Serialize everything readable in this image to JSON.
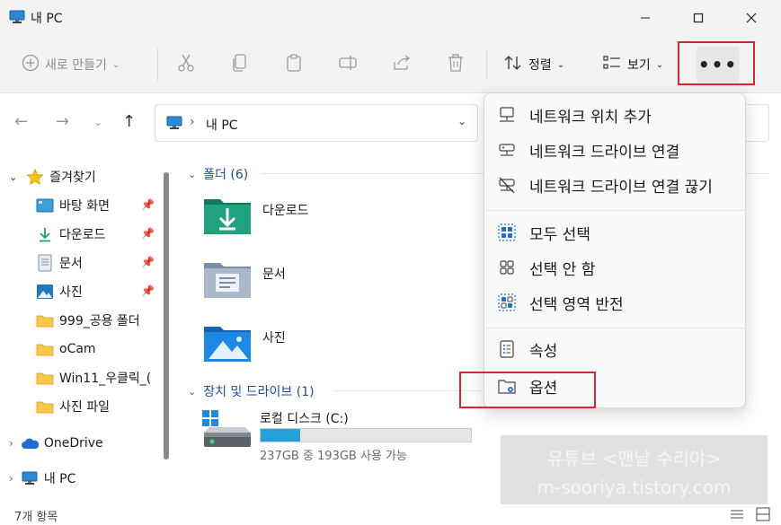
{
  "window": {
    "title": "내 PC"
  },
  "toolbar": {
    "new_label": "새로 만들기",
    "sort_label": "정렬",
    "view_label": "보기",
    "more_label": "•••"
  },
  "address": {
    "path_item": "내 PC"
  },
  "sidebar": {
    "quick_access": "즐겨찾기",
    "items": [
      {
        "label": "바탕 화면",
        "icon": "desktop-icon",
        "pinned": true
      },
      {
        "label": "다운로드",
        "icon": "download-icon",
        "pinned": true
      },
      {
        "label": "문서",
        "icon": "document-icon",
        "pinned": true
      },
      {
        "label": "사진",
        "icon": "pictures-icon",
        "pinned": true
      },
      {
        "label": "999_공용 폴더",
        "icon": "folder-icon",
        "pinned": false
      },
      {
        "label": "oCam",
        "icon": "folder-icon",
        "pinned": false
      },
      {
        "label": "Win11_우클릭_(",
        "icon": "folder-icon",
        "pinned": false
      },
      {
        "label": "사진 파일",
        "icon": "folder-icon",
        "pinned": false
      }
    ],
    "onedrive": "OneDrive",
    "this_pc": "내 PC"
  },
  "content": {
    "folders_header": "폴더 (6)",
    "folders": [
      {
        "name": "다운로드",
        "icon": "downloads-folder-icon"
      },
      {
        "name": "문서",
        "icon": "documents-folder-icon"
      },
      {
        "name": "사진",
        "icon": "pictures-folder-icon"
      }
    ],
    "drives_header": "장치 및 드라이브 (1)",
    "drive": {
      "name": "로컬 디스크 (C:)",
      "info": "237GB 중 193GB 사용 가능",
      "used_fraction": 0.19,
      "fill_color": "#26a0da"
    }
  },
  "menu": {
    "items": [
      {
        "label": "네트워크 위치 추가",
        "icon": "network-location-icon"
      },
      {
        "label": "네트워크 드라이브 연결",
        "icon": "map-network-drive-icon"
      },
      {
        "label": "네트워크 드라이브 연결 끊기",
        "icon": "disconnect-network-drive-icon"
      },
      {
        "label": "모두 선택",
        "icon": "select-all-icon"
      },
      {
        "label": "선택 안 함",
        "icon": "select-none-icon"
      },
      {
        "label": "선택 영역 반전",
        "icon": "invert-selection-icon"
      },
      {
        "label": "속성",
        "icon": "properties-icon"
      },
      {
        "label": "옵션",
        "icon": "options-icon"
      }
    ]
  },
  "status": {
    "count": "7개 항목"
  },
  "watermark": {
    "line1": "유튜브 <맨날 수리야>",
    "line2": "m-sooriya.tistory.com"
  },
  "colors": {
    "highlight": "#d9262e",
    "accent": "#1b4f9e"
  }
}
